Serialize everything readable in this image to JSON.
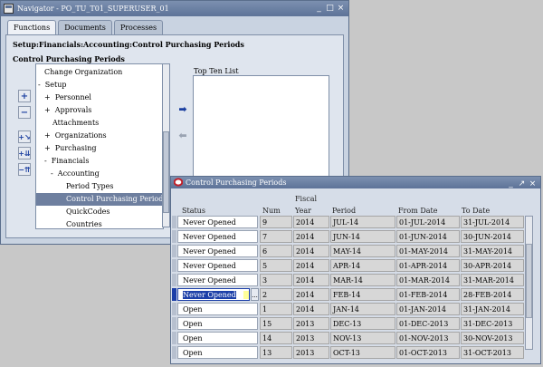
{
  "navigator": {
    "title": "Navigator - PO_TU_T01_SUPERUSER_01",
    "tabs": [
      "Functions",
      "Documents",
      "Processes"
    ],
    "breadcrumb": "Setup:Financials:Accounting:Control Purchasing Periods",
    "subheading": "Control Purchasing Periods",
    "tree": [
      {
        "label": "Change Organization",
        "prefix": ""
      },
      {
        "label": "Setup",
        "prefix": "-"
      },
      {
        "label": "Personnel",
        "prefix": "+"
      },
      {
        "label": "Approvals",
        "prefix": "+"
      },
      {
        "label": "Attachments",
        "prefix": ""
      },
      {
        "label": "Organizations",
        "prefix": "+"
      },
      {
        "label": "Purchasing",
        "prefix": "+"
      },
      {
        "label": "Financials",
        "prefix": "-"
      },
      {
        "label": "Accounting",
        "prefix": "-"
      },
      {
        "label": "Period Types",
        "prefix": ""
      },
      {
        "label": "Control Purchasing Periods",
        "prefix": "",
        "selected": true
      },
      {
        "label": "QuickCodes",
        "prefix": ""
      },
      {
        "label": "Countries",
        "prefix": ""
      }
    ],
    "top_ten_label": "Top Ten List"
  },
  "child": {
    "title": "Control Purchasing Periods",
    "headers": {
      "status": "Status",
      "num": "Num",
      "fiscal": "Fiscal",
      "year": "Year",
      "period": "Period",
      "from": "From Date",
      "to": "To Date"
    },
    "rows": [
      {
        "status": "Never Opened",
        "num": "9",
        "year": "2014",
        "period": "JUL-14",
        "from": "01-JUL-2014",
        "to": "31-JUL-2014"
      },
      {
        "status": "Never Opened",
        "num": "7",
        "year": "2014",
        "period": "JUN-14",
        "from": "01-JUN-2014",
        "to": "30-JUN-2014"
      },
      {
        "status": "Never Opened",
        "num": "6",
        "year": "2014",
        "period": "MAY-14",
        "from": "01-MAY-2014",
        "to": "31-MAY-2014"
      },
      {
        "status": "Never Opened",
        "num": "5",
        "year": "2014",
        "period": "APR-14",
        "from": "01-APR-2014",
        "to": "30-APR-2014"
      },
      {
        "status": "Never Opened",
        "num": "3",
        "year": "2014",
        "period": "MAR-14",
        "from": "01-MAR-2014",
        "to": "31-MAR-2014"
      },
      {
        "status": "Never Opened",
        "num": "2",
        "year": "2014",
        "period": "FEB-14",
        "from": "01-FEB-2014",
        "to": "28-FEB-2014",
        "editing": true
      },
      {
        "status": "Open",
        "num": "1",
        "year": "2014",
        "period": "JAN-14",
        "from": "01-JAN-2014",
        "to": "31-JAN-2014"
      },
      {
        "status": "Open",
        "num": "15",
        "year": "2013",
        "period": "DEC-13",
        "from": "01-DEC-2013",
        "to": "31-DEC-2013"
      },
      {
        "status": "Open",
        "num": "14",
        "year": "2013",
        "period": "NOV-13",
        "from": "01-NOV-2013",
        "to": "30-NOV-2013"
      },
      {
        "status": "Open",
        "num": "13",
        "year": "2013",
        "period": "OCT-13",
        "from": "01-OCT-2013",
        "to": "31-OCT-2013"
      }
    ],
    "lov_button": "..."
  },
  "colors": {
    "title_bar": "#5d7398",
    "selection": "#1c3fa8",
    "tree_selected": "#6e7f9f"
  }
}
